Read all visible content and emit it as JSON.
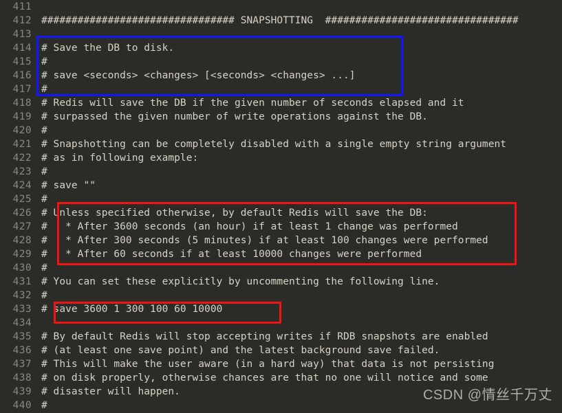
{
  "editor": {
    "background_color": "#2b2b28",
    "line_number_color": "#8a8a80",
    "code_text_color": "#d6d3c8",
    "first_line_number": 411,
    "lines": [
      {
        "no": "411",
        "code": ""
      },
      {
        "no": "412",
        "code": "################################ SNAPSHOTTING  ################################"
      },
      {
        "no": "413",
        "code": ""
      },
      {
        "no": "414",
        "code": "# Save the DB to disk."
      },
      {
        "no": "415",
        "code": "#"
      },
      {
        "no": "416",
        "code": "# save <seconds> <changes> [<seconds> <changes> ...]"
      },
      {
        "no": "417",
        "code": "#"
      },
      {
        "no": "418",
        "code": "# Redis will save the DB if the given number of seconds elapsed and it"
      },
      {
        "no": "419",
        "code": "# surpassed the given number of write operations against the DB."
      },
      {
        "no": "420",
        "code": "#"
      },
      {
        "no": "421",
        "code": "# Snapshotting can be completely disabled with a single empty string argument"
      },
      {
        "no": "422",
        "code": "# as in following example:"
      },
      {
        "no": "423",
        "code": "#"
      },
      {
        "no": "424",
        "code": "# save \"\""
      },
      {
        "no": "425",
        "code": "#"
      },
      {
        "no": "426",
        "code": "# Unless specified otherwise, by default Redis will save the DB:"
      },
      {
        "no": "427",
        "code": "#   * After 3600 seconds (an hour) if at least 1 change was performed"
      },
      {
        "no": "428",
        "code": "#   * After 300 seconds (5 minutes) if at least 100 changes were performed"
      },
      {
        "no": "429",
        "code": "#   * After 60 seconds if at least 10000 changes were performed"
      },
      {
        "no": "430",
        "code": "#"
      },
      {
        "no": "431",
        "code": "# You can set these explicitly by uncommenting the following line."
      },
      {
        "no": "432",
        "code": "#"
      },
      {
        "no": "433",
        "code": "# save 3600 1 300 100 60 10000"
      },
      {
        "no": "434",
        "code": ""
      },
      {
        "no": "435",
        "code": "# By default Redis will stop accepting writes if RDB snapshots are enabled"
      },
      {
        "no": "436",
        "code": "# (at least one save point) and the latest background save failed."
      },
      {
        "no": "437",
        "code": "# This will make the user aware (in a hard way) that data is not persisting"
      },
      {
        "no": "438",
        "code": "# on disk properly, otherwise chances are that no one will notice and some"
      },
      {
        "no": "439",
        "code": "# disaster will happen."
      },
      {
        "no": "440",
        "code": "#"
      }
    ]
  },
  "annotations": [
    {
      "id": "blue-box",
      "color": "#1414ff",
      "covers_lines": "414-417",
      "describes": "# Save the DB to disk. / # save <seconds> <changes> [<seconds> <changes> ...]"
    },
    {
      "id": "red-box-defaults",
      "color": "#f21414",
      "covers_lines": "426-429",
      "describes": "Unless specified otherwise, by default Redis will save the DB: after 3600s/1 change, 300s/100 changes, 60s/10000 changes"
    },
    {
      "id": "red-box-save-line",
      "color": "#f21414",
      "covers_lines": "433",
      "describes": "save 3600 1 300 100 60 10000"
    }
  ],
  "watermark": {
    "text": "CSDN @情丝千万丈"
  }
}
